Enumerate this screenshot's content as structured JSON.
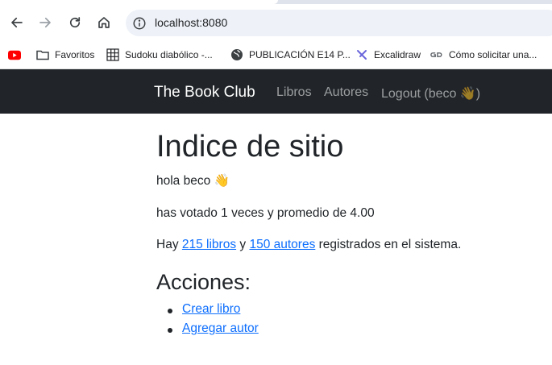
{
  "browser": {
    "url": "localhost:8080",
    "bookmarks": [
      {
        "label": "",
        "icon": "youtube-icon"
      },
      {
        "label": "Favoritos",
        "icon": "folder-icon"
      },
      {
        "label": "Sudoku diabólico -...",
        "icon": "grid-icon"
      },
      {
        "label": "PUBLICACIÓN E14 P...",
        "icon": "globe-icon"
      },
      {
        "label": "Excalidraw",
        "icon": "excalidraw-icon"
      },
      {
        "label": "Cómo solicitar una...",
        "icon": "gd-icon"
      }
    ]
  },
  "navbar": {
    "brand": "The Book Club",
    "links": [
      "Libros",
      "Autores",
      "Logout (beco 👋)"
    ]
  },
  "main": {
    "title": "Indice de sitio",
    "greeting": "hola beco 👋",
    "votes_text": "has votado 1 veces y promedio de 4.00",
    "summary": {
      "prefix": "Hay ",
      "books_link": "215 libros",
      "middle": " y ",
      "authors_link": "150 autores",
      "suffix": " registrados en el sistema."
    },
    "actions_title": "Acciones:",
    "actions": [
      "Crear libro",
      "Agregar autor"
    ]
  },
  "colors": {
    "navbar_bg": "#212529",
    "link": "#0d6efd",
    "text": "#212529"
  }
}
